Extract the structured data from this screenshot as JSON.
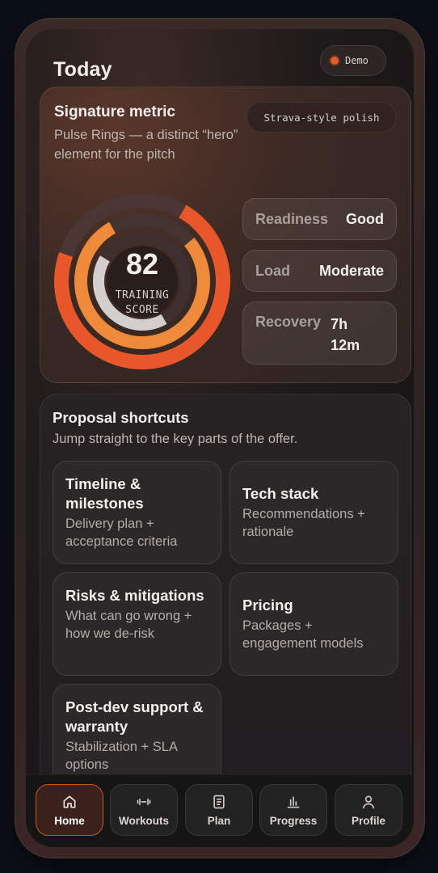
{
  "header": {
    "title": "Today",
    "demo_label": "Demo"
  },
  "hero": {
    "title": "Signature metric",
    "subtitle": "Pulse Rings — a distinct “hero” element for the pitch",
    "badge": "Strava-style polish",
    "score": "82",
    "score_label_1": "TRAINING",
    "score_label_2": "SCORE",
    "rings": [
      {
        "name": "outer",
        "fill": 0.72,
        "color": "#e8572a"
      },
      {
        "name": "middle",
        "fill": 0.78,
        "color": "#ef8a3b"
      },
      {
        "name": "inner",
        "fill": 0.42,
        "color": "#d4cfcc"
      }
    ],
    "metrics": [
      {
        "key": "Readiness",
        "value": "Good"
      },
      {
        "key": "Load",
        "value": "Moderate"
      },
      {
        "key": "Recovery",
        "value_line1": "7h",
        "value_line2": "12m"
      }
    ]
  },
  "shortcuts": {
    "title": "Proposal shortcuts",
    "subtitle": "Jump straight to the key parts of the offer.",
    "tiles": [
      {
        "title": "Timeline & milestones",
        "desc": "Delivery plan + acceptance criteria"
      },
      {
        "title": "Tech stack",
        "desc": "Recommendations + rationale"
      },
      {
        "title": "Risks & mitigations",
        "desc": "What can go wrong + how we de-risk"
      },
      {
        "title": "Pricing",
        "desc": "Packages + engagement models"
      },
      {
        "title": "Post-dev support & warranty",
        "desc": "Stabilization + SLA options"
      }
    ]
  },
  "nav": {
    "items": [
      {
        "label": "Home",
        "icon": "home-icon",
        "active": true
      },
      {
        "label": "Workouts",
        "icon": "dumbbell-icon",
        "active": false
      },
      {
        "label": "Plan",
        "icon": "document-icon",
        "active": false
      },
      {
        "label": "Progress",
        "icon": "bar-chart-icon",
        "active": false
      },
      {
        "label": "Profile",
        "icon": "user-icon",
        "active": false
      }
    ]
  },
  "colors": {
    "accent": "#e8572a",
    "accent_light": "#ef8a3b",
    "background": "#141315"
  }
}
